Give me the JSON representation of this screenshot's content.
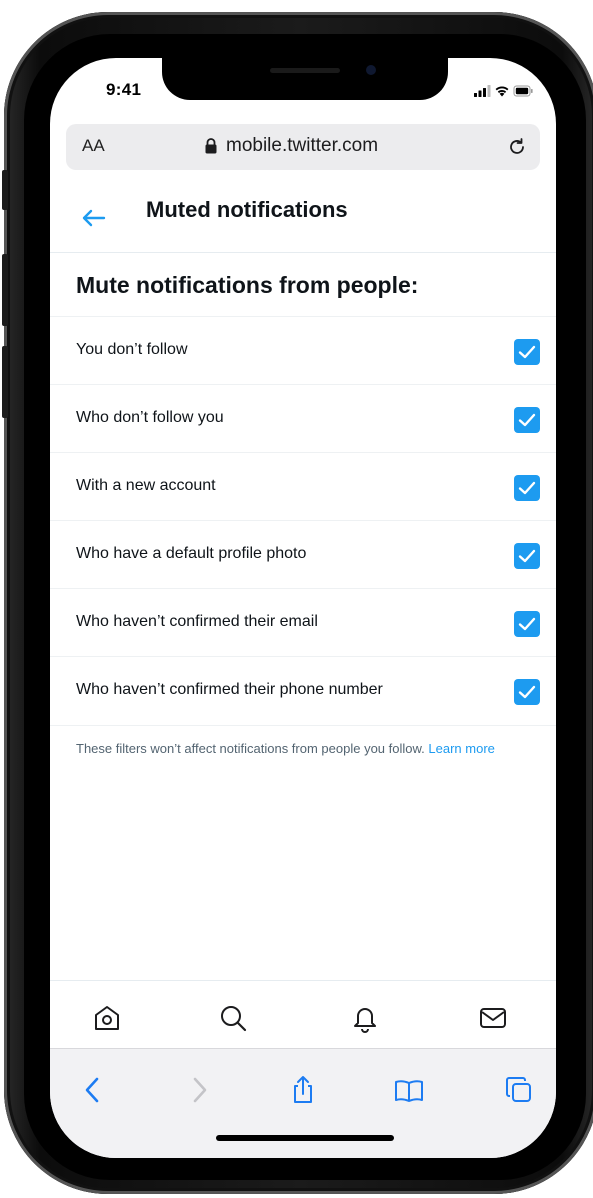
{
  "status_bar": {
    "time": "9:41"
  },
  "browser": {
    "text_size_label": "AA",
    "url": "mobile.twitter.com"
  },
  "header": {
    "title": "Muted notifications"
  },
  "section": {
    "title": "Mute notifications from people:"
  },
  "options": [
    {
      "label": "You don’t follow",
      "checked": true
    },
    {
      "label": "Who don’t follow you",
      "checked": true
    },
    {
      "label": "With a new account",
      "checked": true
    },
    {
      "label": "Who have a default profile photo",
      "checked": true
    },
    {
      "label": "Who haven’t confirmed their email",
      "checked": true
    },
    {
      "label": "Who haven’t confirmed their phone number",
      "checked": true
    }
  ],
  "footnote": {
    "text": "These filters won’t affect notifications from people you follow.",
    "link": "Learn more"
  },
  "tw_nav": {
    "icons": [
      "home-icon",
      "search-icon",
      "notifications-bell-icon",
      "messages-envelope-icon"
    ]
  },
  "safari_toolbar": {
    "icons": [
      "back-chevron-icon",
      "forward-chevron-icon",
      "share-icon",
      "bookmarks-book-icon",
      "tabs-icon"
    ]
  },
  "colors": {
    "accent": "#1d9bf0",
    "text_primary": "#0f1419",
    "text_secondary": "#536471"
  }
}
